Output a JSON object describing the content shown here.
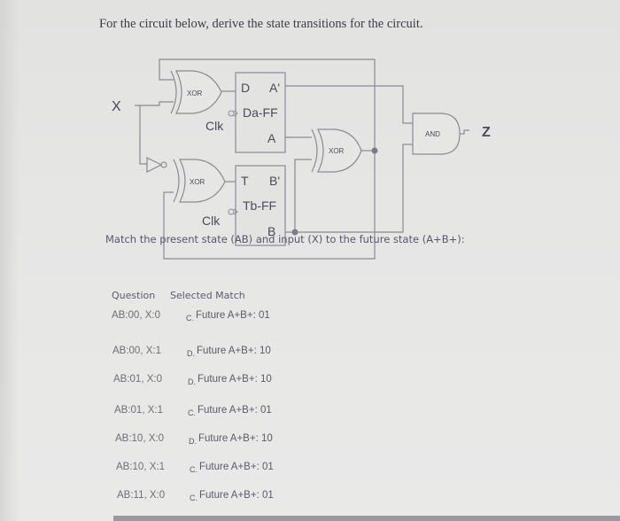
{
  "title": "For the circuit below, derive the state transitions for the circuit.",
  "circuit": {
    "input_label": "X",
    "output_label": "Z",
    "gates": {
      "xor_top": "XOR",
      "xor_bottom": "XOR",
      "xor_right": "XOR",
      "and_gate": "AND"
    },
    "ff_a": {
      "d": "D",
      "q_bar": "A'",
      "name": "Da-FF",
      "q": "A",
      "clk": "Clk"
    },
    "ff_b": {
      "t": "T",
      "q_bar": "B'",
      "name": "Tb-FF",
      "q": "B",
      "clk": "Clk"
    }
  },
  "prompt": "Match the  present state  (AB) and input (X) to the future state (A+B+):",
  "table": {
    "question_header": "Question",
    "match_header": "Selected Match",
    "rows": [
      {
        "question": "AB:00, X:0",
        "letter": "C.",
        "answer": "Future A+B+: 01"
      },
      {
        "question": "AB:00, X:1",
        "letter": "D.",
        "answer": "Future A+B+: 10"
      },
      {
        "question": "AB:01, X:0",
        "letter": "D.",
        "answer": "Future A+B+: 10"
      },
      {
        "question": "AB:01, X:1",
        "letter": "C.",
        "answer": "Future A+B+: 01"
      },
      {
        "question": "AB:10, X:0",
        "letter": "D.",
        "answer": "Future A+B+: 10"
      },
      {
        "question": "AB:10, X:1",
        "letter": "C.",
        "answer": "Future A+B+: 01"
      },
      {
        "question": "AB:11, X:0",
        "letter": "C.",
        "answer": "Future A+B+: 01"
      }
    ]
  }
}
